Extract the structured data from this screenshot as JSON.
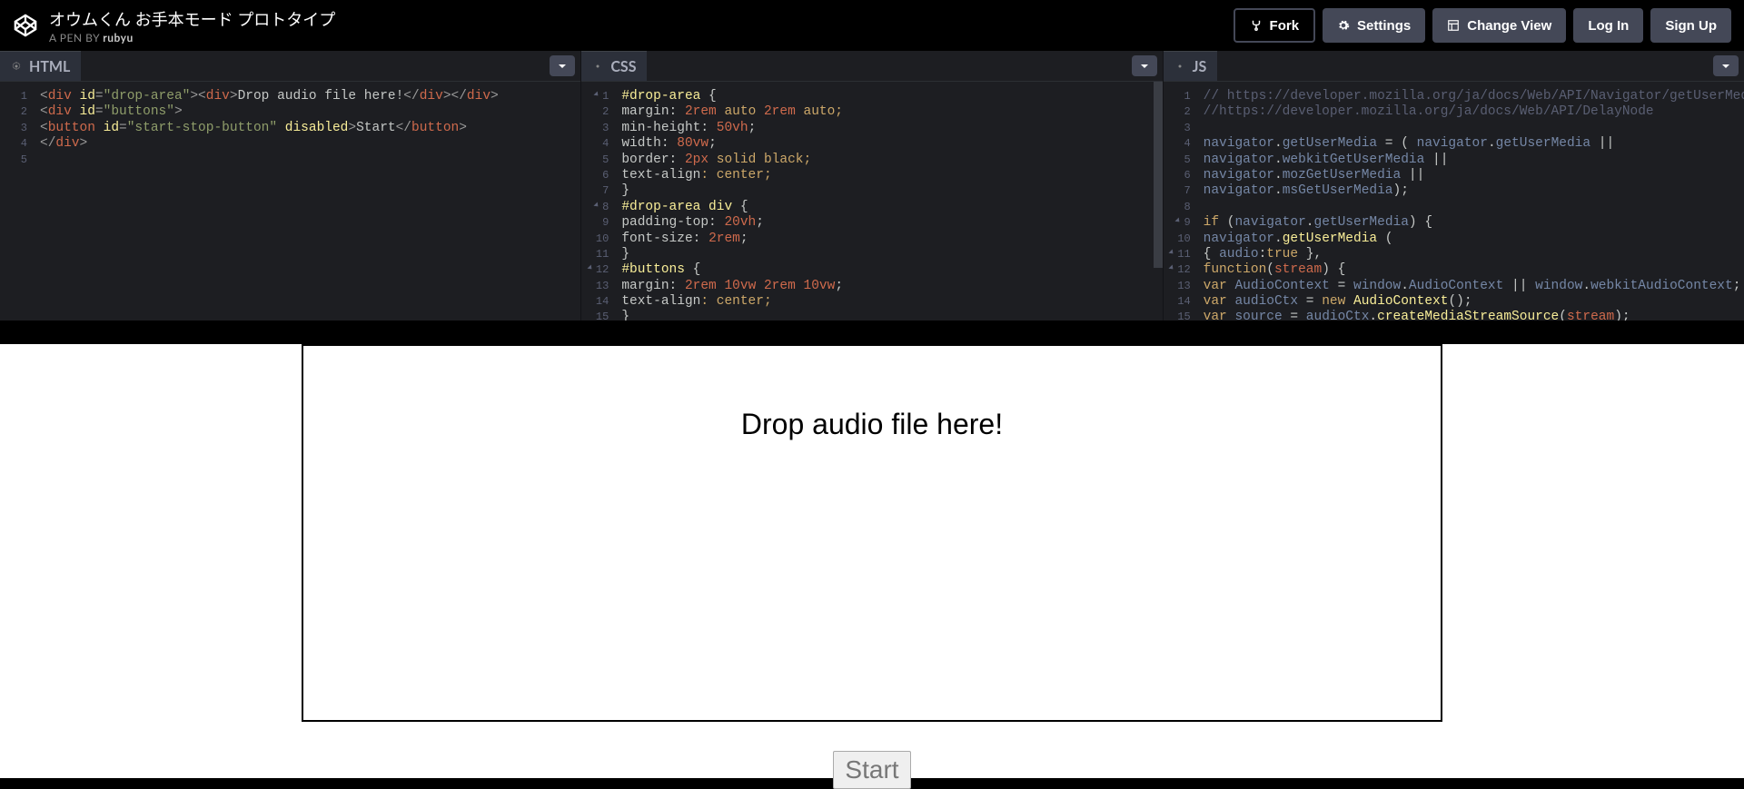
{
  "header": {
    "pen_title": "オウムくん お手本モード プロトタイプ",
    "byline_prefix": "A PEN BY ",
    "byline_author": "rubyu",
    "buttons": {
      "fork": "Fork",
      "settings": "Settings",
      "change_view": "Change View",
      "log_in": "Log In",
      "sign_up": "Sign Up"
    }
  },
  "panels": {
    "html": {
      "label": "HTML"
    },
    "css": {
      "label": "CSS"
    },
    "js": {
      "label": "JS"
    }
  },
  "code": {
    "html_lines": [
      "1",
      "2",
      "3",
      "4",
      "5"
    ],
    "html": {
      "l1_a": "<",
      "l1_b": "div",
      "l1_c": " id",
      "l1_d": "=",
      "l1_e": "\"drop-area\"",
      "l1_f": "><",
      "l1_g": "div",
      "l1_h": ">",
      "l1_i": "Drop audio file here!",
      "l1_j": "</",
      "l1_k": "div",
      "l1_l": "></",
      "l1_m": "div",
      "l1_n": ">",
      "l2_a": "<",
      "l2_b": "div",
      "l2_c": " id",
      "l2_d": "=",
      "l2_e": "\"buttons\"",
      "l2_f": ">",
      "l3_a": "  <",
      "l3_b": "button",
      "l3_c": " id",
      "l3_d": "=",
      "l3_e": "\"start-stop-button\"",
      "l3_f": " disabled",
      "l3_g": ">",
      "l3_h": "Start",
      "l3_i": "</",
      "l3_j": "button",
      "l3_k": ">",
      "l4_a": "</",
      "l4_b": "div",
      "l4_c": ">"
    },
    "css_lines": [
      "1",
      "2",
      "3",
      "4",
      "5",
      "6",
      "7",
      "8",
      "9",
      "10",
      "11",
      "12",
      "13",
      "14",
      "15"
    ],
    "css": {
      "l1": "#drop-area",
      "l1b": " {",
      "l2a": "  margin",
      "l2b": ": ",
      "l2c": "2rem",
      "l2d": " auto ",
      "l2e": "2rem",
      "l2f": " auto;",
      "l3a": "  min-height",
      "l3b": ": ",
      "l3c": "50vh",
      "l3d": ";",
      "l4a": "  width",
      "l4b": ": ",
      "l4c": "80vw",
      "l4d": ";",
      "l5a": "  border",
      "l5b": ": ",
      "l5c": "2px",
      "l5d": " solid black;",
      "l6a": "  text-align",
      "l6b": ": center;",
      "l7": "}",
      "l8": "#drop-area div",
      "l8b": " {",
      "l9a": "  padding-top",
      "l9b": ": ",
      "l9c": "20vh",
      "l9d": ";",
      "l10a": "  font-size",
      "l10b": ": ",
      "l10c": "2rem",
      "l10d": ";",
      "l11": "}",
      "l12": "#buttons",
      "l12b": " {",
      "l13a": "  margin",
      "l13b": ": ",
      "l13c": "2rem",
      "l13d": " ",
      "l13e": "10vw",
      "l13f": " ",
      "l13g": "2rem",
      "l13h": " ",
      "l13i": "10vw",
      "l13j": ";",
      "l14a": "  text-align",
      "l14b": ": center;",
      "l15": "}"
    },
    "js_lines": [
      "1",
      "2",
      "3",
      "4",
      "5",
      "6",
      "7",
      "8",
      "9",
      "10",
      "11",
      "12",
      "13",
      "14",
      "15"
    ],
    "js": {
      "l1": "// https://developer.mozilla.org/ja/docs/Web/API/Navigator/getUserMedia",
      "l2": "//https://developer.mozilla.org/ja/docs/Web/API/DelayNode",
      "l4a": "navigator",
      "l4b": ".",
      "l4c": "getUserMedia",
      "l4d": " = ( ",
      "l4e": "navigator",
      "l4f": ".",
      "l4g": "getUserMedia",
      "l4h": " ||",
      "l5a": "                           ",
      "l5b": "navigator",
      "l5c": ".",
      "l5d": "webkitGetUserMedia",
      "l5e": " ||",
      "l6a": "                           ",
      "l6b": "navigator",
      "l6c": ".",
      "l6d": "mozGetUserMedia",
      "l6e": " ||",
      "l7a": "                           ",
      "l7b": "navigator",
      "l7c": ".",
      "l7d": "msGetUserMedia",
      "l7e": ");",
      "l9a": "if",
      "l9b": " (",
      "l9c": "navigator",
      "l9d": ".",
      "l9e": "getUserMedia",
      "l9f": ") {",
      "l10a": "   ",
      "l10b": "navigator",
      "l10c": ".",
      "l10d": "getUserMedia",
      "l10e": " (",
      "l11a": "      { ",
      "l11b": "audio",
      "l11c": ":",
      "l11d": "true",
      "l11e": " },",
      "l12a": "      ",
      "l12b": "function",
      "l12c": "(",
      "l12d": "stream",
      "l12e": ") {",
      "l13a": "         ",
      "l13b": "var",
      "l13c": " AudioContext",
      "l13d": " = ",
      "l13e": "window",
      "l13f": ".",
      "l13g": "AudioContext",
      "l13h": " || ",
      "l13i": "window",
      "l13j": ".",
      "l13k": "webkitAudioContext",
      "l13l": ";",
      "l14a": "         ",
      "l14b": "var",
      "l14c": " audioCtx",
      "l14d": " = ",
      "l14e": "new",
      "l14f": " ",
      "l14g": "AudioContext",
      "l14h": "();",
      "l15a": "         ",
      "l15b": "var",
      "l15c": " source",
      "l15d": " = ",
      "l15e": "audioCtx",
      "l15f": ".",
      "l15g": "createMediaStreamSource",
      "l15h": "(",
      "l15i": "stream",
      "l15j": ");"
    }
  },
  "preview": {
    "drop_text": "Drop audio file here!",
    "start_label": "Start"
  }
}
